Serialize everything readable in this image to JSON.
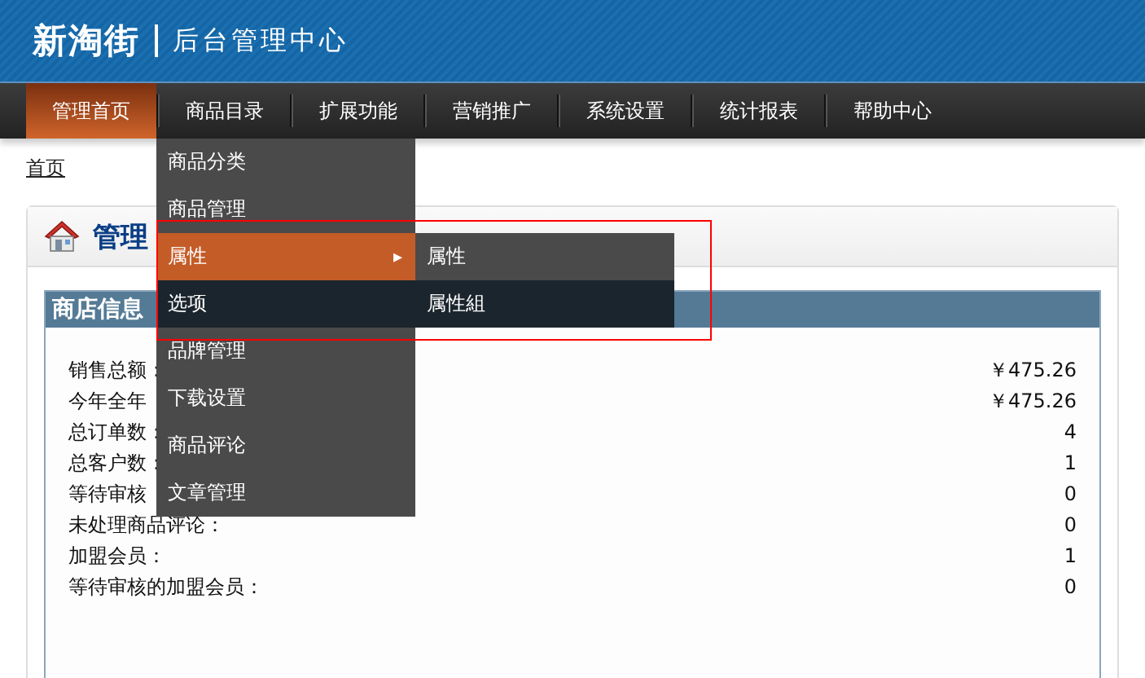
{
  "header": {
    "logo": "新淘街",
    "subtitle": "后台管理中心"
  },
  "nav": [
    {
      "label": "管理首页",
      "selected": true
    },
    {
      "label": "商品目录",
      "selected": false
    },
    {
      "label": "扩展功能",
      "selected": false
    },
    {
      "label": "营销推广",
      "selected": false
    },
    {
      "label": "系统设置",
      "selected": false
    },
    {
      "label": "统计报表",
      "selected": false
    },
    {
      "label": "帮助中心",
      "selected": false
    }
  ],
  "dropdown": {
    "items": [
      {
        "label": "商品分类",
        "selected": false,
        "hovered": false
      },
      {
        "label": "商品管理",
        "selected": false,
        "hovered": false
      },
      {
        "label": "属性",
        "selected": true,
        "hovered": false,
        "arrow": "▸"
      },
      {
        "label": "选项",
        "selected": false,
        "hovered": true
      },
      {
        "label": "品牌管理",
        "selected": false,
        "hovered": false
      },
      {
        "label": "下载设置",
        "selected": false,
        "hovered": false
      },
      {
        "label": "商品评论",
        "selected": false,
        "hovered": false
      },
      {
        "label": "文章管理",
        "selected": false,
        "hovered": false
      }
    ],
    "submenu": [
      {
        "label": "属性",
        "hovered": false
      },
      {
        "label": "属性組",
        "hovered": true
      }
    ]
  },
  "breadcrumb": "首页",
  "panel": {
    "title": "管理",
    "section": "商店信息",
    "rows": [
      {
        "label": "销售总额：",
        "value": "￥475.26"
      },
      {
        "label": "今年全年",
        "value": "￥475.26"
      },
      {
        "label": "总订单数：",
        "value": "4"
      },
      {
        "label": "总客户数：",
        "value": "1"
      },
      {
        "label": "等待审核",
        "value": "0"
      },
      {
        "label": "未处理商品评论：",
        "value": "0"
      },
      {
        "label": "加盟会员：",
        "value": "1"
      },
      {
        "label": "等待审核的加盟会员：",
        "value": "0"
      }
    ]
  }
}
